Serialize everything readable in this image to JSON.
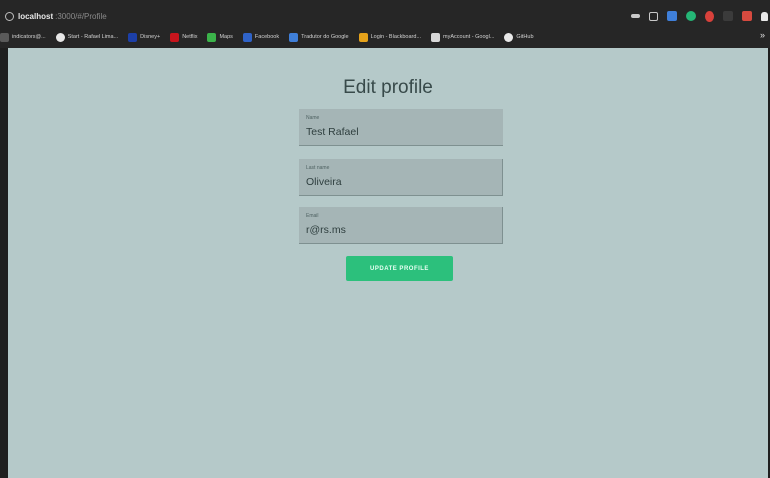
{
  "browser": {
    "url_host": "localhost",
    "url_path": ":3000/#/Profile",
    "bookmarks": [
      {
        "label": "indicators@...",
        "color": "#5a5a5a",
        "round": false
      },
      {
        "label": "Start - Rafael Lima...",
        "color": "#e7e7e7",
        "round": true
      },
      {
        "label": "Disney+",
        "color": "#1c3fa8",
        "round": false
      },
      {
        "label": "Netflix",
        "color": "#c8151d",
        "round": false
      },
      {
        "label": "Maps",
        "color": "#3bb34a",
        "round": false
      },
      {
        "label": "Facebook",
        "color": "#2f63c8",
        "round": false
      },
      {
        "label": "Tradutor do Google",
        "color": "#3f7fd9",
        "round": false
      },
      {
        "label": "Login - Blackboard...",
        "color": "#e5a21a",
        "round": false
      },
      {
        "label": "myAccount - Googl...",
        "color": "#d8d8d8",
        "round": false
      },
      {
        "label": "GitHub",
        "color": "#e8e8e8",
        "round": true
      }
    ],
    "more": "»"
  },
  "page": {
    "title": "Edit profile",
    "fields": {
      "name": {
        "label": "Name",
        "value": "Test Rafael"
      },
      "last_name": {
        "label": "Last name",
        "value": "Oliveira"
      },
      "email": {
        "label": "Email",
        "value": "r@rs.ms"
      }
    },
    "update_button": "UPDATE PROFILE"
  },
  "colors": {
    "page_bg": "#b5c9c9",
    "accent": "#2cc07c"
  }
}
